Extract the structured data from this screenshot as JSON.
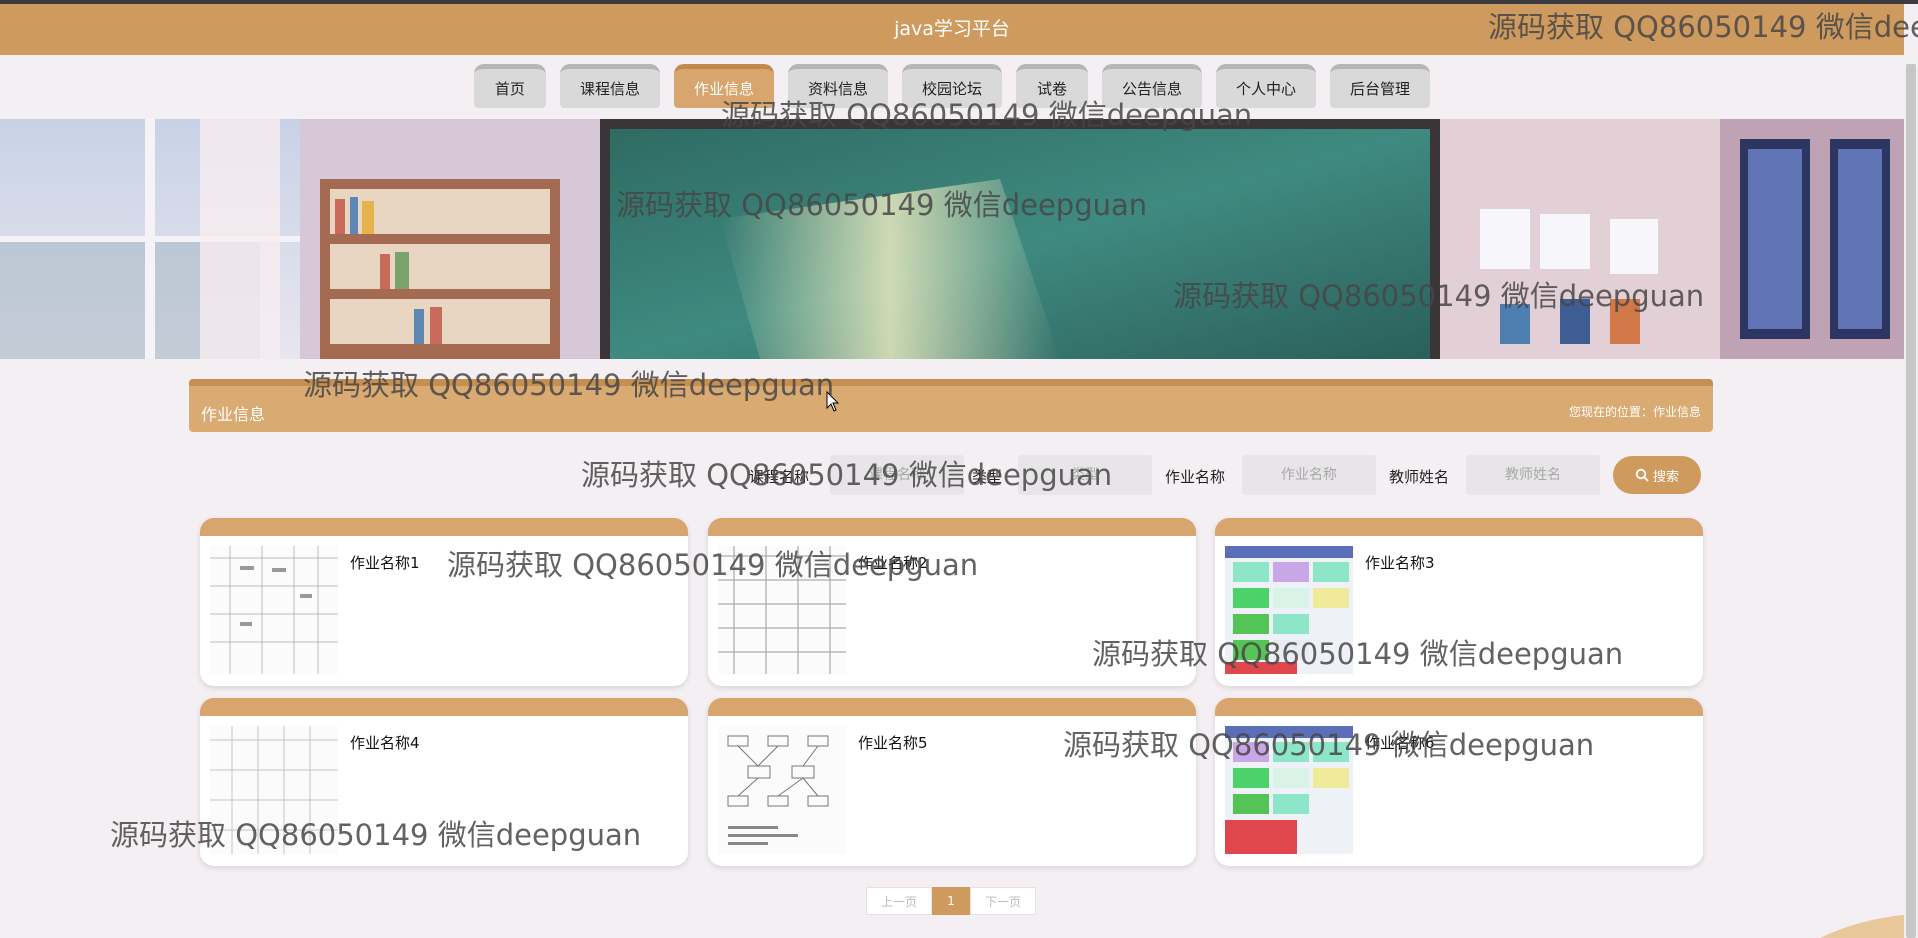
{
  "header": {
    "title": "java学习平台"
  },
  "nav": {
    "items": [
      {
        "label": "首页"
      },
      {
        "label": "课程信息"
      },
      {
        "label": "作业信息"
      },
      {
        "label": "资料信息"
      },
      {
        "label": "校园论坛"
      },
      {
        "label": "试卷"
      },
      {
        "label": "公告信息"
      },
      {
        "label": "个人中心"
      },
      {
        "label": "后台管理"
      }
    ],
    "active_label": "作业信息"
  },
  "section": {
    "title": "作业信息",
    "location": "您现在的位置：作业信息"
  },
  "search": {
    "course_label": "课程名称",
    "course_placeholder": "课程名称",
    "type_label": "类型",
    "type_placeholder": "类型",
    "name_label": "作业名称",
    "name_placeholder": "作业名称",
    "teacher_label": "教师姓名",
    "teacher_placeholder": "教师姓名",
    "button_label": "搜索"
  },
  "cards": [
    {
      "name": "作业名称1",
      "thumb": "table"
    },
    {
      "name": "作业名称2",
      "thumb": "table"
    },
    {
      "name": "作业名称3",
      "thumb": "schedule"
    },
    {
      "name": "作业名称4",
      "thumb": "table"
    },
    {
      "name": "作业名称5",
      "thumb": "flow"
    },
    {
      "name": "作业名称6",
      "thumb": "schedule"
    }
  ],
  "pagination": {
    "prev": "上一页",
    "current": "1",
    "next": "下一页"
  },
  "watermark": {
    "text": "源码获取 QQ86050149 微信deepguan",
    "corner_text": "源码获取 QQ86050149 微信dee"
  },
  "colors": {
    "primary": "#cf9a5e",
    "accent_tab": "#d7a56d",
    "page_bg": "#f4eff3"
  }
}
